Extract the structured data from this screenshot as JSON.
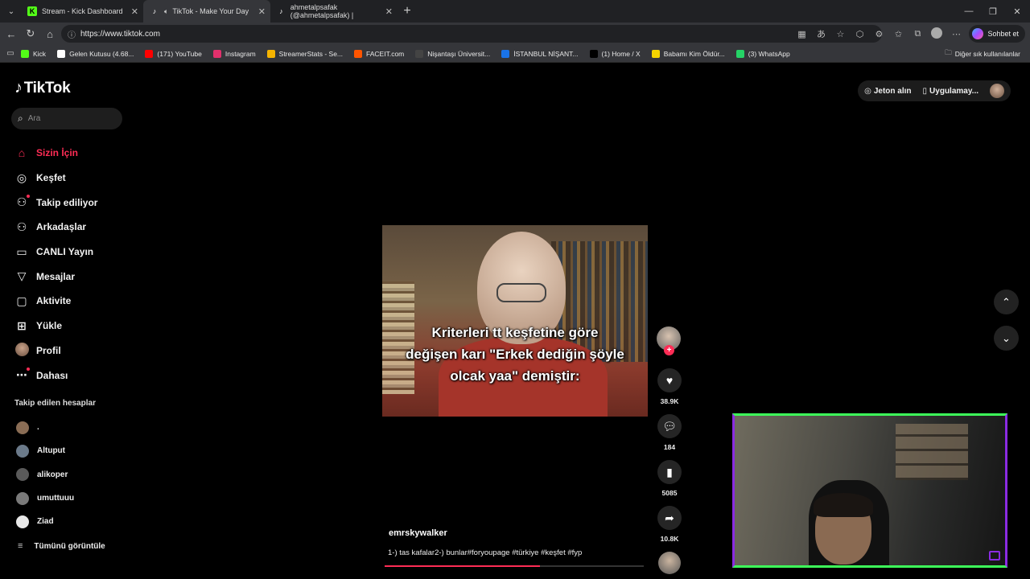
{
  "browser": {
    "tabs": [
      {
        "label": "Stream - Kick Dashboard",
        "icon": "kick-icon"
      },
      {
        "label": "TikTok - Make Your Day",
        "icon": "tiktok-icon"
      },
      {
        "label": "ahmetalpsafak (@ahmetalpsafak) |",
        "icon": "tiktok-icon"
      }
    ],
    "url": "https://www.tiktok.com",
    "copilot_label": "Sohbet et",
    "bookmarks": [
      {
        "label": "Kick",
        "color": "#53fc18"
      },
      {
        "label": "Gelen Kutusu (4.68...",
        "color": "#ffffff"
      },
      {
        "label": "(171) YouTube",
        "color": "#ff0000"
      },
      {
        "label": "Instagram",
        "color": "#e1306c"
      },
      {
        "label": "StreamerStats - Se...",
        "color": "#f5b400"
      },
      {
        "label": "FACEIT.com",
        "color": "#ff5500"
      },
      {
        "label": "Nişantaşı Üniversit...",
        "color": "#444444"
      },
      {
        "label": "İSTANBUL NİŞANT...",
        "color": "#1a73e8"
      },
      {
        "label": "(1) Home / X",
        "color": "#000000"
      },
      {
        "label": "Babamı Kim Öldür...",
        "color": "#f5d400"
      },
      {
        "label": "(3) WhatsApp",
        "color": "#25d366"
      }
    ],
    "other_bookmarks": "Diğer sık kullanılanlar"
  },
  "tiktok": {
    "brand": "TikTok",
    "search_placeholder": "Ara",
    "nav": [
      {
        "label": "Sizin İçin",
        "icon": "home-icon",
        "active": true
      },
      {
        "label": "Keşfet",
        "icon": "compass-icon"
      },
      {
        "label": "Takip ediliyor",
        "icon": "following-icon"
      },
      {
        "label": "Arkadaşlar",
        "icon": "friends-icon"
      },
      {
        "label": "CANLI Yayın",
        "icon": "live-icon"
      },
      {
        "label": "Mesajlar",
        "icon": "messages-icon"
      },
      {
        "label": "Aktivite",
        "icon": "activity-icon"
      },
      {
        "label": "Yükle",
        "icon": "upload-icon"
      },
      {
        "label": "Profil",
        "icon": "profile-avatar"
      },
      {
        "label": "Dahası",
        "icon": "more-icon"
      }
    ],
    "following_title": "Takip edilen hesaplar",
    "following": [
      ".",
      "Altuput",
      "alikoper",
      "umuttuuu",
      "Ziad"
    ],
    "see_all": "Tümünü görüntüle",
    "top_right": {
      "coins": "Jeton alın",
      "app": "Uygulamay..."
    },
    "video": {
      "caption_lines": [
        "Kriterleri tt keşfetine göre",
        "değişen karı \"Erkek dediğin şöyle",
        "olcak yaa\" demiştir:"
      ],
      "author": "emrskywalker",
      "description": "1-) tas kafalar2-) bunlar#foryoupage #türkiye #keşfet #fyp",
      "likes": "38.9K",
      "comments": "184",
      "saves": "5085",
      "shares": "10.8K",
      "progress": 0.6
    },
    "accent": "#fe2c55"
  }
}
